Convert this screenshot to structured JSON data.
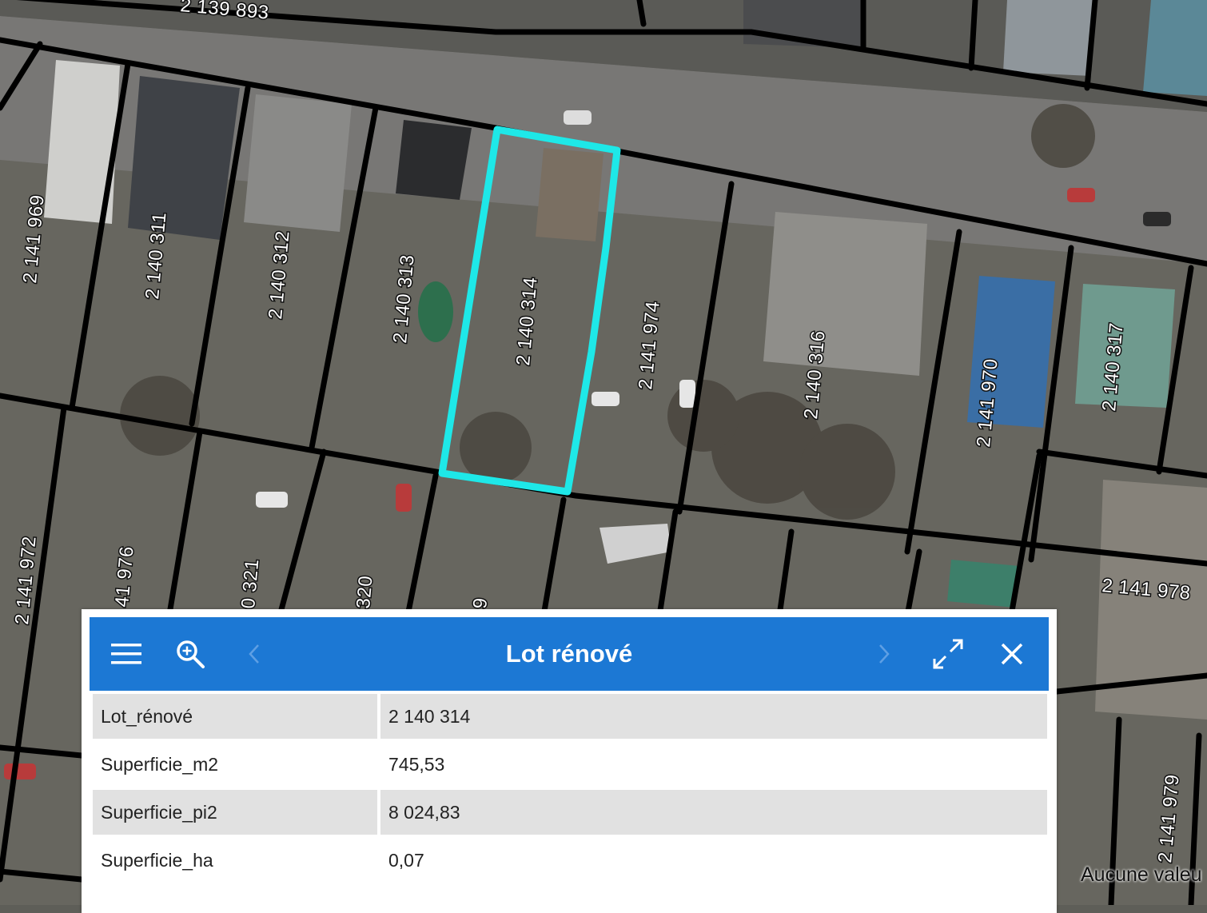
{
  "map": {
    "selected_lot": "2 140 314",
    "highlight_color": "#1ee8e8",
    "parcel_line_color": "#000000",
    "lot_labels": [
      "2 139 893",
      "2 141 969",
      "2 140 311",
      "2 140 312",
      "2 140 313",
      "2 140 314",
      "2 141 974",
      "2 140 316",
      "2 141 970",
      "2 140 317",
      "2 141 972",
      "41 976",
      "0 321",
      "320",
      "9",
      "2 141 978",
      "2 141 979"
    ],
    "no_value_text": "Aucune valeu"
  },
  "popup": {
    "title": "Lot rénové",
    "header_color": "#1c78d4",
    "icons": {
      "menu": "hamburger-menu-icon",
      "zoom": "zoom-in-icon",
      "prev": "chevron-left-icon",
      "next": "chevron-right-icon",
      "expand": "expand-icon",
      "close": "close-icon"
    },
    "rows": [
      {
        "key": "Lot_rénové",
        "value": "2 140 314"
      },
      {
        "key": "Superficie_m2",
        "value": "745,53"
      },
      {
        "key": "Superficie_pi2",
        "value": "8 024,83"
      },
      {
        "key": "Superficie_ha",
        "value": "0,07"
      }
    ]
  }
}
